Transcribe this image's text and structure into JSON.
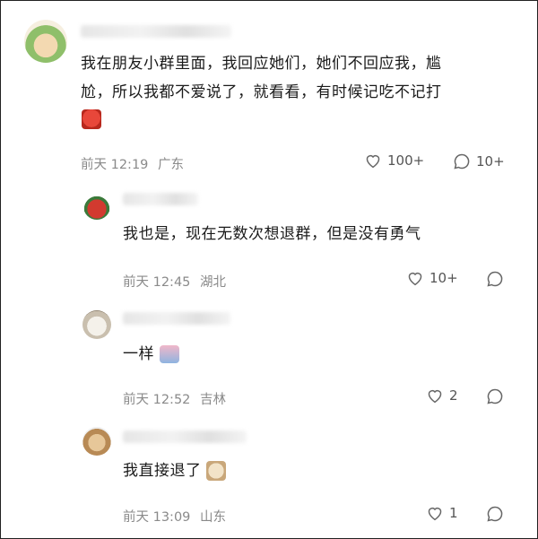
{
  "comments": [
    {
      "text_line1": "我在朋友小群里面，我回应她们，她们不回应我，尴",
      "text_line2": "尬，所以我都不爱说了，就看看，有时候记吃不记打",
      "time": "前天 12:19",
      "location": "广东",
      "likes": "100+",
      "replies": "10+"
    },
    {
      "text": "我也是，现在无数次想退群，但是没有勇气",
      "time": "前天 12:45",
      "location": "湖北",
      "likes": "10+"
    },
    {
      "text": "一样",
      "time": "前天 12:52",
      "location": "吉林",
      "likes": "2"
    },
    {
      "text": "我直接退了",
      "time": "前天 13:09",
      "location": "山东",
      "likes": "1"
    }
  ],
  "icons": {
    "like": "heart-outline-icon",
    "reply": "speech-bubble-icon"
  },
  "colors": {
    "meta": "#8a8a8a",
    "text": "#1a1a1a"
  }
}
